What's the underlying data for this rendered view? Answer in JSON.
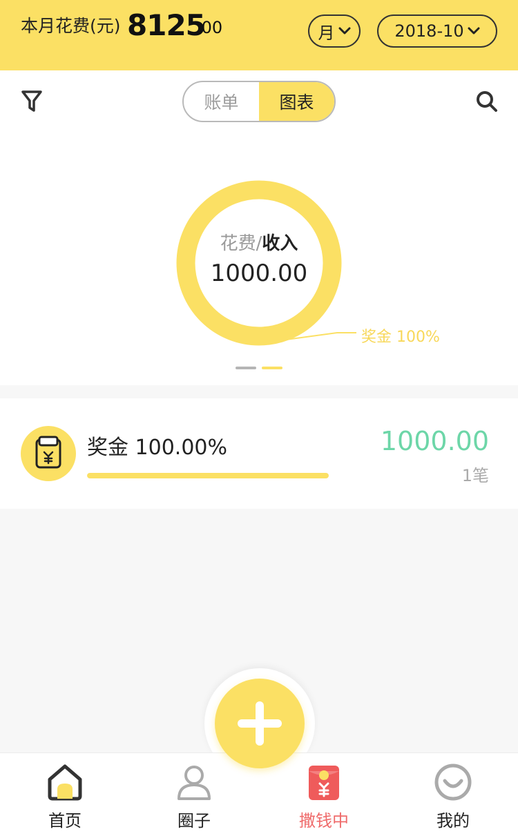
{
  "header": {
    "spend_label": "本月花费(元)",
    "spend_integer": "8125",
    "spend_decimal": ".00",
    "period_label": "月",
    "date_label": "2018-10"
  },
  "toolbar": {
    "tabs": [
      {
        "label": "账单",
        "active": false
      },
      {
        "label": "图表",
        "active": true
      }
    ],
    "filter_icon": "filter-icon",
    "search_icon": "search-icon"
  },
  "chart_data": {
    "type": "pie",
    "donut": true,
    "center_label_muted": "花费/",
    "center_label_strong": "收入",
    "center_value": "1000.00",
    "slices": [
      {
        "label": "奖金",
        "value": 100,
        "percent_label": "奖金 100%",
        "color": "#fbe064"
      }
    ]
  },
  "pager": {
    "dots": 2,
    "active": 1
  },
  "categories": [
    {
      "name_label": "奖金 100.00%",
      "percent": 100,
      "amount": "1000.00",
      "count": "1笔",
      "icon": "bonus-wallet-icon",
      "amount_color": "#6dd6a8"
    }
  ],
  "nav": {
    "items": [
      {
        "label": "首页",
        "icon": "home-icon"
      },
      {
        "label": "圈子",
        "icon": "person-icon"
      },
      {
        "label": "撒钱中",
        "icon": "red-packet-icon"
      },
      {
        "label": "我的",
        "icon": "smile-icon"
      }
    ],
    "fab_icon": "plus-icon"
  },
  "colors": {
    "accent": "#fbe064",
    "income": "#6dd6a8",
    "red": "#ef6b6b"
  }
}
